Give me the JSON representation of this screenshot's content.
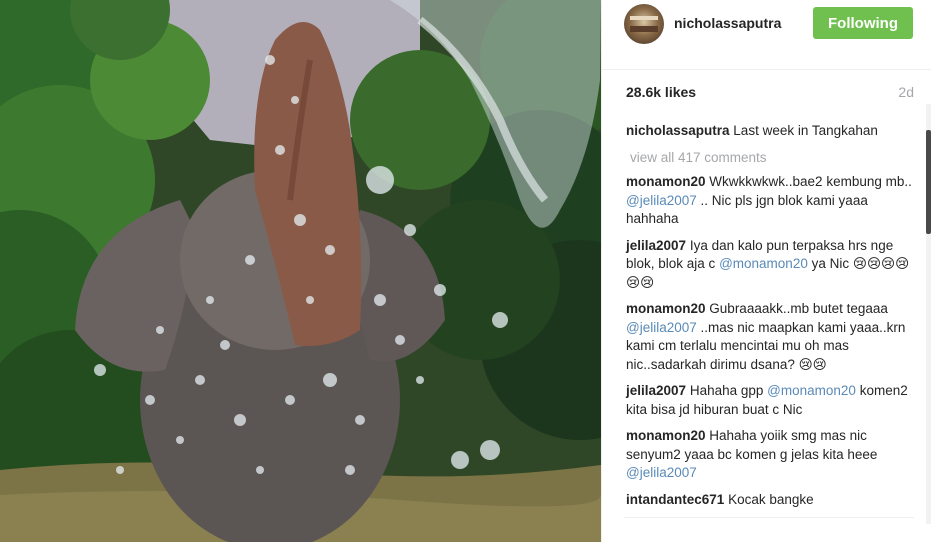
{
  "post": {
    "username": "nicholassaputra",
    "follow_label": "Following",
    "likes": "28.6k likes",
    "age": "2d",
    "caption_user": "nicholassaputra",
    "caption_text": "Last week in Tangkahan",
    "view_all": "view all 417 comments"
  },
  "comments": [
    {
      "user": "monamon20",
      "text": "Wkwkkwkwk..bae2 kembung mb..",
      "mention": "@jelila2007",
      "text2": ".. Nic pls jgn blok kami yaaa hahhaha"
    },
    {
      "user": "jelila2007",
      "text": "Iya dan kalo pun terpaksa hrs nge blok, blok aja c",
      "mention": "@monamon20",
      "text2": "ya Nic 😢😢😢😢😢😢"
    },
    {
      "user": "monamon20",
      "text": "Gubraaaakk..mb butet tegaaa",
      "mention": "@jelila2007",
      "text2": "..mas nic maapkan kami yaaa..krn kami cm terlalu mencintai mu oh mas nic..sadarkah dirimu dsana? 😢😢"
    },
    {
      "user": "jelila2007",
      "text": "Hahaha gpp",
      "mention": "@monamon20",
      "text2": "komen2 kita bisa jd hiburan buat c Nic"
    },
    {
      "user": "monamon20",
      "text": "Hahaha yoiik smg mas nic senyum2 yaaa bc komen g jelas kita heee",
      "mention": "@jelila2007",
      "text2": ""
    },
    {
      "user": "intandantec671",
      "text": "Kocak bangke",
      "mention": "",
      "text2": ""
    }
  ],
  "colors": {
    "follow_bg": "#70c050",
    "mention": "#5a8ab8",
    "muted": "#a5a7aa"
  },
  "icons": {
    "avatar": "profile-photo"
  }
}
